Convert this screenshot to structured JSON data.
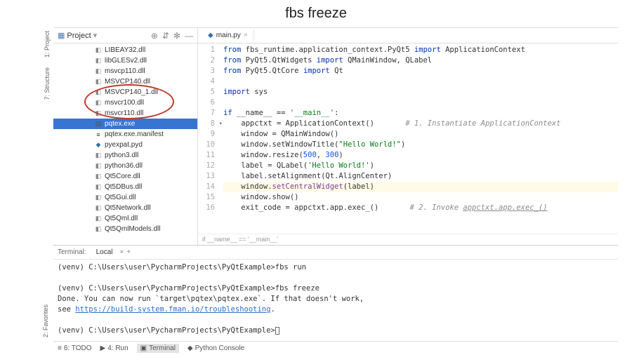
{
  "title": "fbs freeze",
  "side_tabs": {
    "project": "1: Project",
    "structure": "7: Structure"
  },
  "favorites_tab": "2: Favorites",
  "project_panel": {
    "title": "Project",
    "icons": {
      "target": "⊕",
      "split": "⇵",
      "gear": "✻",
      "collapse": "—"
    },
    "tree": [
      {
        "icon": "dll",
        "name": "LIBEAY32.dll"
      },
      {
        "icon": "dll",
        "name": "libGLESv2.dll"
      },
      {
        "icon": "dll",
        "name": "msvcp110.dll"
      },
      {
        "icon": "dll",
        "name": "MSVCP140.dll"
      },
      {
        "icon": "dll",
        "name": "MSVCP140_1.dll"
      },
      {
        "icon": "dll",
        "name": "msvcr100.dll"
      },
      {
        "icon": "dll",
        "name": "msvcr110.dll"
      },
      {
        "icon": "exe",
        "name": "pqtex.exe",
        "selected": true
      },
      {
        "icon": "txt",
        "name": "pqtex.exe.manifest"
      },
      {
        "icon": "py",
        "name": "pyexpat.pyd"
      },
      {
        "icon": "dll",
        "name": "python3.dll"
      },
      {
        "icon": "dll",
        "name": "python36.dll"
      },
      {
        "icon": "dll",
        "name": "Qt5Core.dll"
      },
      {
        "icon": "dll",
        "name": "Qt5DBus.dll"
      },
      {
        "icon": "dll",
        "name": "Qt5Gui.dll"
      },
      {
        "icon": "dll",
        "name": "Qt5Network.dll"
      },
      {
        "icon": "dll",
        "name": "Qt5Qml.dll"
      },
      {
        "icon": "dll",
        "name": "Qt5QmlModels.dll"
      }
    ]
  },
  "editor": {
    "tab": {
      "icon": "py",
      "name": "main.py"
    },
    "lines": [
      {
        "n": 1,
        "html": "<span class='kw'>from</span> fbs_runtime.application_context.PyQt5 <span class='kw'>import</span> ApplicationContext"
      },
      {
        "n": 2,
        "html": "<span class='kw'>from</span> PyQt5.QtWidgets <span class='kw'>import</span> QMainWindow, QLabel"
      },
      {
        "n": 3,
        "html": "<span class='kw'>from</span> PyQt5.QtCore <span class='kw'>import</span> Qt"
      },
      {
        "n": 4,
        "html": ""
      },
      {
        "n": 5,
        "html": "<span class='kw'>import</span> sys"
      },
      {
        "n": 6,
        "html": ""
      },
      {
        "n": 7,
        "html": "<span class='kw'>if</span> __name__ == <span class='str'>'__main__'</span>:"
      },
      {
        "n": 8,
        "html": "    appctxt = ApplicationContext()       <span class='cm'># 1. Instantiate ApplicationContext</span>"
      },
      {
        "n": 9,
        "html": "    window = QMainWindow()"
      },
      {
        "n": 10,
        "html": "    window.setWindowTitle(<span class='str'>\"Hello World!\"</span>)"
      },
      {
        "n": 11,
        "html": "    window.resize(<span class='num'>500</span>, <span class='num'>300</span>)"
      },
      {
        "n": 12,
        "html": "    label = QLabel(<span class='str'>'Hello World!'</span>)"
      },
      {
        "n": 13,
        "html": "    label.setAlignment(Qt.AlignCenter)"
      },
      {
        "n": 14,
        "hl": true,
        "html": "    window.<span class='fn'>setCentralWidget</span>(label)"
      },
      {
        "n": 15,
        "html": "    window.show()"
      },
      {
        "n": 16,
        "html": "    exit_code = appctxt.app.exec_()       <span class='cm'># 2. Invoke <u>appctxt.app.exec_()</u></span>"
      }
    ],
    "breadcrumb": "if __name__ == '__main__'"
  },
  "terminal": {
    "label": "Terminal:",
    "tab": "Local",
    "lines": [
      "(venv) C:\\Users\\user\\PycharmProjects\\PyQtExample>fbs run",
      "",
      "(venv) C:\\Users\\user\\PycharmProjects\\PyQtExample>fbs freeze",
      "Done. You can now run `target\\pqtex\\pqtex.exe`. If that doesn't work,",
      "see <a href='#'>https://build-system.fman.io/troubleshooting</a>.",
      "",
      "(venv) C:\\Users\\user\\PycharmProjects\\PyQtExample><span class='cursor'></span>"
    ]
  },
  "status_bar": {
    "todo": "6: TODO",
    "run": "4: Run",
    "terminal": "Terminal",
    "python_console": "Python Console"
  }
}
